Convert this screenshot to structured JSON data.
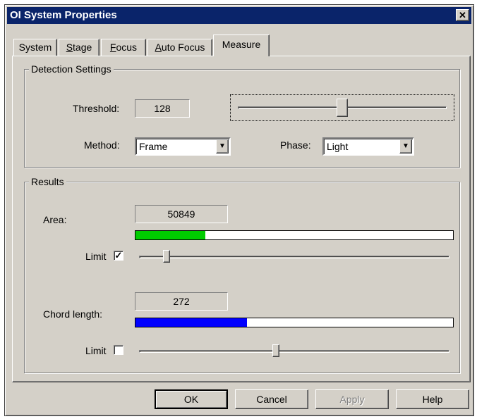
{
  "window": {
    "title": "OI System Properties",
    "close_glyph": "✕"
  },
  "tabs": [
    {
      "label": "System"
    },
    {
      "label_pre": "",
      "label_u": "S",
      "label_post": "tage"
    },
    {
      "label_pre": "",
      "label_u": "F",
      "label_post": "ocus"
    },
    {
      "label_pre": "",
      "label_u": "A",
      "label_post": "uto Focus"
    },
    {
      "label": "Measure",
      "active": true
    }
  ],
  "detection": {
    "group_label": "Detection Settings",
    "threshold_label": "Threshold:",
    "threshold_value": "128",
    "threshold_slider_fraction": 0.5,
    "method_label": "Method:",
    "method_value": "Frame",
    "phase_label": "Phase:",
    "phase_value": "Light"
  },
  "results": {
    "group_label": "Results",
    "area_label": "Area:",
    "area_value": "50849",
    "area_bar_fraction": 0.22,
    "area_bar_color": "#00cc00",
    "area_limit_label": "Limit",
    "area_limit_checked": true,
    "area_limit_mark": "✓",
    "area_slider_fraction": 0.08,
    "chord_label": "Chord length:",
    "chord_value": "272",
    "chord_bar_fraction": 0.35,
    "chord_bar_color": "#0000ff",
    "chord_limit_label": "Limit",
    "chord_limit_checked": false,
    "chord_limit_mark": "",
    "chord_slider_fraction": 0.44
  },
  "buttons": {
    "ok": "OK",
    "cancel": "Cancel",
    "apply": "Apply",
    "help": "Help"
  },
  "icons": {
    "dropdown": "▼"
  }
}
